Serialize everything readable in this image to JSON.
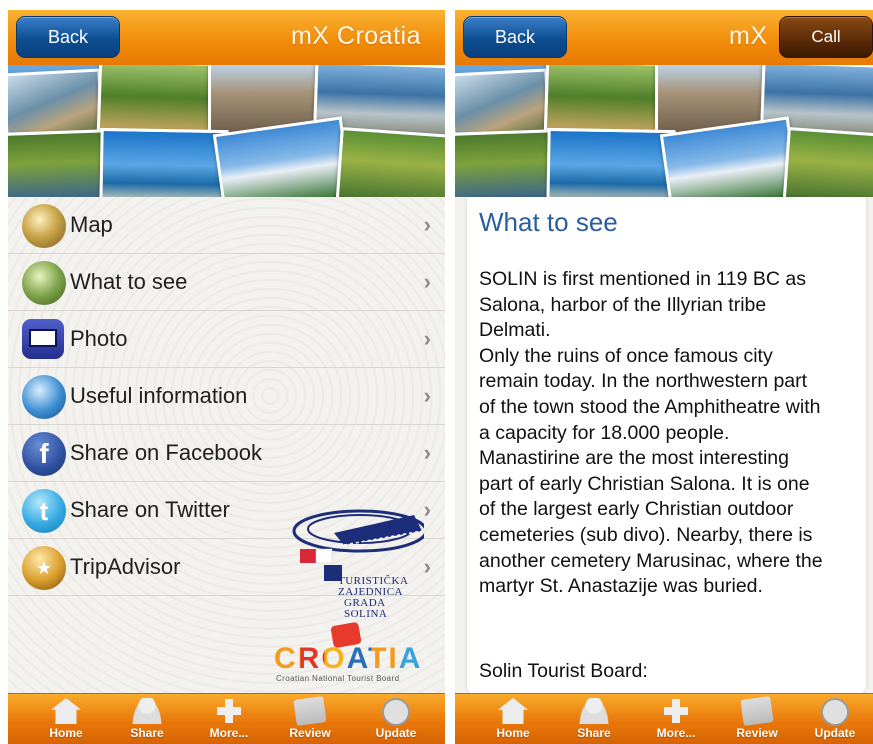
{
  "left": {
    "header": {
      "back_label": "Back",
      "title": "mX Croatia"
    },
    "menu": [
      {
        "label": "Map",
        "icon": "map-icon"
      },
      {
        "label": "What to see",
        "icon": "magnifier-icon"
      },
      {
        "label": "Photo",
        "icon": "film-icon"
      },
      {
        "label": "Useful information",
        "icon": "info-icon"
      },
      {
        "label": "Share on Facebook",
        "icon": "facebook-icon"
      },
      {
        "label": "Share on Twitter",
        "icon": "twitter-icon"
      },
      {
        "label": "TripAdvisor",
        "icon": "tripadvisor-icon"
      }
    ],
    "logos": {
      "tourist_board": [
        "TURISTIČKA",
        "ZAJEDNICA",
        "GRADA",
        "SOLINA"
      ],
      "croatia_word": "CROATIA",
      "croatia_sub": "Croatian National Tourist Board"
    }
  },
  "right": {
    "header": {
      "back_label": "Back",
      "title": "mX C",
      "call_label": "Call"
    },
    "panel": {
      "title": "What to see",
      "body": "SOLIN is first mentioned in 119 BC as\nSalona, harbor of the Illyrian tribe\nDelmati.\nOnly the ruins of once famous city\nremain today. In the northwestern part\nof the town stood the Amphitheatre with\na capacity for 18.000 people.\nManastirine are the most interesting\npart of early Christian Salona. It is one\nof the largest early Christian outdoor\ncemeteries (sub divo). Nearby, there is\nanother cemetery Marusinac, where the\nmartyr St. Anastazije was buried.",
      "footer": "Solin Tourist Board:"
    }
  },
  "tabbar": [
    {
      "label": "Home",
      "icon": "home-icon"
    },
    {
      "label": "Share",
      "icon": "share-person-icon"
    },
    {
      "label": "More...",
      "icon": "plus-icon"
    },
    {
      "label": "Review",
      "icon": "review-icon"
    },
    {
      "label": "Update",
      "icon": "update-icon"
    }
  ],
  "colors": {
    "header_orange": "#f08a08",
    "back_blue": "#0d4e92",
    "call_brown": "#5a2a06",
    "title_blue": "#2a5f9c"
  }
}
